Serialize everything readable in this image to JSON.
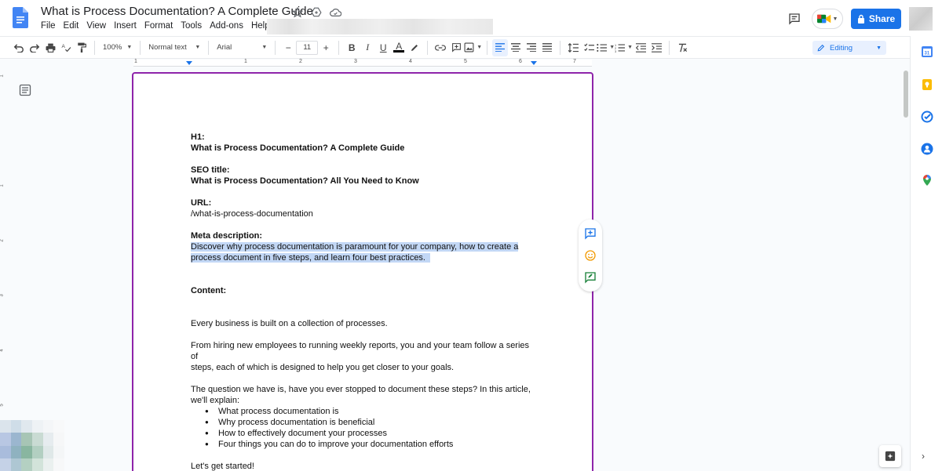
{
  "title_bar": {
    "doc_title": "What is Process Documentation? A Complete Guide",
    "menu": [
      "File",
      "Edit",
      "View",
      "Insert",
      "Format",
      "Tools",
      "Add-ons",
      "Help"
    ],
    "share_label": "Share"
  },
  "toolbar": {
    "zoom": "100%",
    "style": "Normal text",
    "font": "Arial",
    "font_size": "11",
    "minus": "−",
    "plus": "+",
    "mode": "Editing"
  },
  "ruler": {
    "numbers": [
      "1",
      "1",
      "2",
      "3",
      "4",
      "5",
      "6",
      "7"
    ]
  },
  "document": {
    "h1_label": "H1:",
    "h1_text": "What is Process Documentation? A Complete Guide",
    "seo_label": "SEO title:",
    "seo_text": "What is Process Documentation? All You Need to Know",
    "url_label": "URL:",
    "url_text": "/what-is-process-documentation",
    "meta_label": "Meta description:",
    "meta_line1": "Discover why process documentation is paramount for your company, how to create a",
    "meta_line2": "process document in five steps, and learn four best practices.",
    "content_label": "Content:",
    "p1": "Every business is built on a collection of processes.",
    "p2_line1": "From hiring new employees to running weekly reports, you and your team follow a series of",
    "p2_line2": "steps, each of which is designed to help you get closer to your goals.",
    "p3_line1": "The question we have is, have you ever stopped to document these steps? In this article,",
    "p3_line2": "we'll explain:",
    "bullets": [
      "What process documentation is",
      "Why process documentation is beneficial",
      "How to effectively document your processes",
      "Four things you can do to improve your documentation efforts"
    ],
    "closing": "Let's get started!"
  },
  "colors": {
    "accent": "#1a73e8",
    "page_border": "#8e24aa",
    "highlight": "#c2d7f5"
  }
}
